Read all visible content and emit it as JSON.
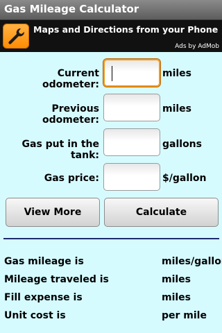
{
  "title": "Gas Mileage Calculator",
  "ad": {
    "text": "Maps and Directions from your Phone",
    "attribution": "Ads by AdMob",
    "icon": "wrench-icon",
    "icon_color": "#ff8a00"
  },
  "form": {
    "current_odometer": {
      "label": "Current odometer:",
      "unit": "miles",
      "value": ""
    },
    "previous_odometer": {
      "label": "Previous odometer:",
      "unit": "miles",
      "value": ""
    },
    "gas_amount": {
      "label": "Gas put in the tank:",
      "unit": "gallons",
      "value": ""
    },
    "gas_price": {
      "label": "Gas price:",
      "unit": "$/gallon",
      "value": ""
    }
  },
  "buttons": {
    "view_more": "View More",
    "calculate": "Calculate"
  },
  "results": {
    "mileage": {
      "label": "Gas mileage is",
      "unit": "miles/gallon"
    },
    "traveled": {
      "label": "Mileage traveled is",
      "unit": "miles"
    },
    "expense": {
      "label": "Fill expense is",
      "unit": "miles"
    },
    "unit_cost": {
      "label": "Unit cost is",
      "unit": "per mile"
    }
  },
  "colors": {
    "background": "#d6fbff",
    "focus": "#f39a1b",
    "divider": "#1c2a6b"
  }
}
